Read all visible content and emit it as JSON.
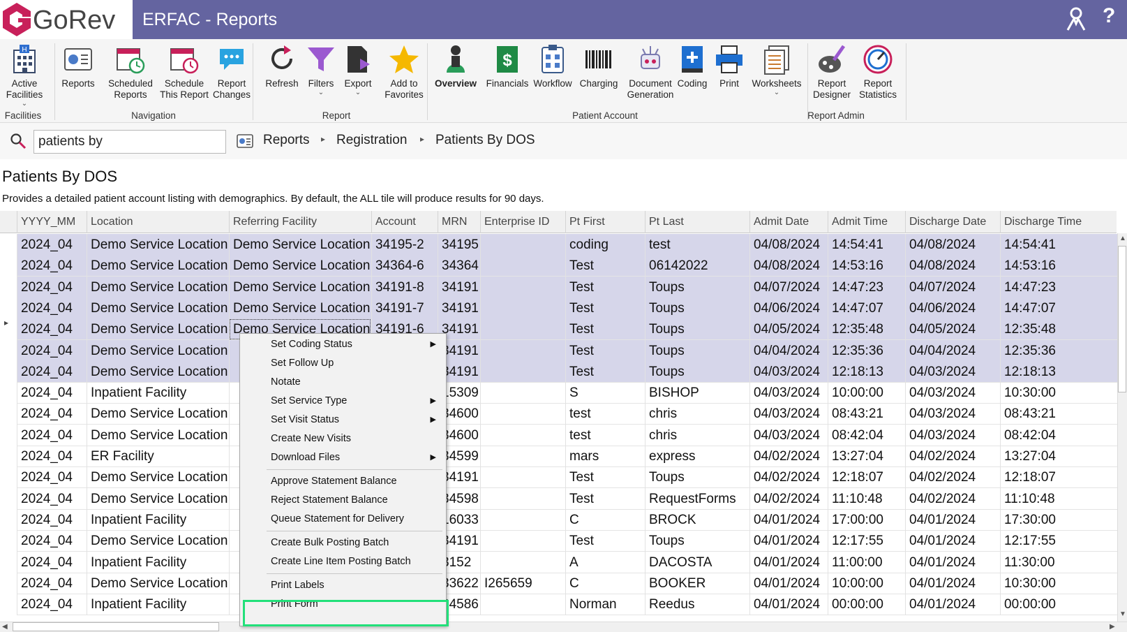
{
  "brand": {
    "logo_text": "GoRev",
    "accent": "#6464a0",
    "logo_color": "#c8205a"
  },
  "window": {
    "title": "ERFAC - Reports"
  },
  "ribbon": {
    "buttons": [
      {
        "label": "Active\nFacilities",
        "icon": "building-icon"
      },
      {
        "label": "Reports",
        "icon": "reports-icon"
      },
      {
        "label": "Scheduled\nReports",
        "icon": "calendar-clock-icon"
      },
      {
        "label": "Schedule\nThis Report",
        "icon": "calendar-alarm-icon"
      },
      {
        "label": "Report\nChanges",
        "icon": "chat-bubble-icon"
      },
      {
        "label": "Refresh",
        "icon": "refresh-icon"
      },
      {
        "label": "Filters",
        "icon": "funnel-icon"
      },
      {
        "label": "Export",
        "icon": "export-icon"
      },
      {
        "label": "Add to\nFavorites",
        "icon": "star-icon"
      },
      {
        "label": "Overview",
        "icon": "person-icon"
      },
      {
        "label": "Financials",
        "icon": "dollar-icon"
      },
      {
        "label": "Workflow",
        "icon": "clipboard-icon"
      },
      {
        "label": "Charging",
        "icon": "barcode-icon"
      },
      {
        "label": "Document\nGeneration",
        "icon": "document-generation-icon"
      },
      {
        "label": "Coding",
        "icon": "book-plus-icon"
      },
      {
        "label": "Print",
        "icon": "printer-icon"
      },
      {
        "label": "Worksheets",
        "icon": "worksheets-icon"
      },
      {
        "label": "Report\nDesigner",
        "icon": "palette-icon"
      },
      {
        "label": "Report\nStatistics",
        "icon": "gauge-icon"
      }
    ],
    "groups": [
      "Facilities",
      "Navigation",
      "Report",
      "Patient Account",
      "Report Admin"
    ]
  },
  "search": {
    "value": "patients by"
  },
  "breadcrumb": [
    "Reports",
    "Registration",
    "Patients By DOS"
  ],
  "page": {
    "title": "Patients By DOS",
    "description": "Provides a detailed patient account listing with demographics. By default, the ALL tile will produce results for 90 days."
  },
  "grid": {
    "columns": [
      "YYYY_MM",
      "Location",
      "Referring Facility",
      "Account",
      "MRN",
      "Enterprise ID",
      "Pt First",
      "Pt Last",
      "Admit Date",
      "Admit Time",
      "Discharge Date",
      "Discharge Time"
    ],
    "rows": [
      [
        "2024_04",
        "Demo Service Location",
        "Demo Service Location",
        "34195-2",
        "34195",
        "",
        "coding",
        "test",
        "04/08/2024",
        "14:54:41",
        "04/08/2024",
        "14:54:41"
      ],
      [
        "2024_04",
        "Demo Service Location",
        "Demo Service Location",
        "34364-6",
        "34364",
        "",
        "Test",
        "06142022",
        "04/08/2024",
        "14:53:16",
        "04/08/2024",
        "14:53:16"
      ],
      [
        "2024_04",
        "Demo Service Location",
        "Demo Service Location",
        "34191-8",
        "34191",
        "",
        "Test",
        "Toups",
        "04/07/2024",
        "14:47:23",
        "04/07/2024",
        "14:47:23"
      ],
      [
        "2024_04",
        "Demo Service Location",
        "Demo Service Location",
        "34191-7",
        "34191",
        "",
        "Test",
        "Toups",
        "04/06/2024",
        "14:47:07",
        "04/06/2024",
        "14:47:07"
      ],
      [
        "2024_04",
        "Demo Service Location",
        "Demo Service Location",
        "34191-6",
        "34191",
        "",
        "Test",
        "Toups",
        "04/05/2024",
        "12:35:48",
        "04/05/2024",
        "12:35:48"
      ],
      [
        "2024_04",
        "Demo Service Location",
        "",
        "",
        "34191",
        "",
        "Test",
        "Toups",
        "04/04/2024",
        "12:35:36",
        "04/04/2024",
        "12:35:36"
      ],
      [
        "2024_04",
        "Demo Service Location",
        "",
        "",
        "34191",
        "",
        "Test",
        "Toups",
        "04/03/2024",
        "12:18:13",
        "04/03/2024",
        "12:18:13"
      ],
      [
        "2024_04",
        "Inpatient Facility",
        "",
        "",
        "15309",
        "",
        "S",
        "BISHOP",
        "04/03/2024",
        "10:00:00",
        "04/03/2024",
        "10:30:00"
      ],
      [
        "2024_04",
        "Demo Service Location",
        "",
        "",
        "34600",
        "",
        "test",
        "chris",
        "04/03/2024",
        "08:43:21",
        "04/03/2024",
        "08:43:21"
      ],
      [
        "2024_04",
        "Demo Service Location",
        "",
        "",
        "34600",
        "",
        "test",
        "chris",
        "04/03/2024",
        "08:42:04",
        "04/03/2024",
        "08:42:04"
      ],
      [
        "2024_04",
        "ER Facility",
        "",
        "",
        "34599",
        "",
        "mars",
        "express",
        "04/02/2024",
        "13:27:04",
        "04/02/2024",
        "13:27:04"
      ],
      [
        "2024_04",
        "Demo Service Location",
        "",
        "",
        "34191",
        "",
        "Test",
        "Toups",
        "04/02/2024",
        "12:18:07",
        "04/02/2024",
        "12:18:07"
      ],
      [
        "2024_04",
        "Demo Service Location",
        "",
        "",
        "34598",
        "",
        "Test",
        "RequestForms",
        "04/02/2024",
        "11:10:48",
        "04/02/2024",
        "11:10:48"
      ],
      [
        "2024_04",
        "Inpatient Facility",
        "",
        "",
        "16033",
        "",
        "C",
        "BROCK",
        "04/01/2024",
        "17:00:00",
        "04/01/2024",
        "17:30:00"
      ],
      [
        "2024_04",
        "Demo Service Location",
        "",
        "",
        "34191",
        "",
        "Test",
        "Toups",
        "04/01/2024",
        "12:17:55",
        "04/01/2024",
        "12:17:55"
      ],
      [
        "2024_04",
        "Inpatient Facility",
        "",
        "",
        "3152",
        "",
        "A",
        "DACOSTA",
        "04/01/2024",
        "11:00:00",
        "04/01/2024",
        "11:30:00"
      ],
      [
        "2024_04",
        "Demo Service Location",
        "",
        "",
        "33622",
        "I265659",
        "C",
        "BOOKER",
        "04/01/2024",
        "10:00:00",
        "04/01/2024",
        "10:30:00"
      ],
      [
        "2024_04",
        "Inpatient Facility",
        "",
        "",
        "34586",
        "",
        "Norman",
        "Reedus",
        "04/01/2024",
        "00:00:00",
        "04/01/2024",
        "00:00:00"
      ]
    ],
    "selected_rows": 7,
    "current_row": 4
  },
  "context_menu": {
    "items": [
      {
        "label": "Set Coding Status",
        "submenu": true
      },
      {
        "label": "Set Follow Up",
        "submenu": false
      },
      {
        "label": "Notate",
        "submenu": false
      },
      {
        "label": "Set Service Type",
        "submenu": true
      },
      {
        "label": "Set Visit Status",
        "submenu": true
      },
      {
        "label": "Create New Visits",
        "submenu": false
      },
      {
        "label": "Download Files",
        "submenu": true
      },
      {
        "separator": true
      },
      {
        "label": "Approve Statement Balance",
        "submenu": false
      },
      {
        "label": "Reject Statement Balance",
        "submenu": false
      },
      {
        "label": "Queue Statement for Delivery",
        "submenu": false
      },
      {
        "separator": true
      },
      {
        "label": "Create Bulk Posting Batch",
        "submenu": false
      },
      {
        "label": "Create Line Item Posting Batch",
        "submenu": false
      },
      {
        "separator": true
      },
      {
        "label": "Print Labels",
        "submenu": false
      },
      {
        "label": "Print Form",
        "submenu": false
      }
    ],
    "highlight_color": "#22e07a"
  }
}
